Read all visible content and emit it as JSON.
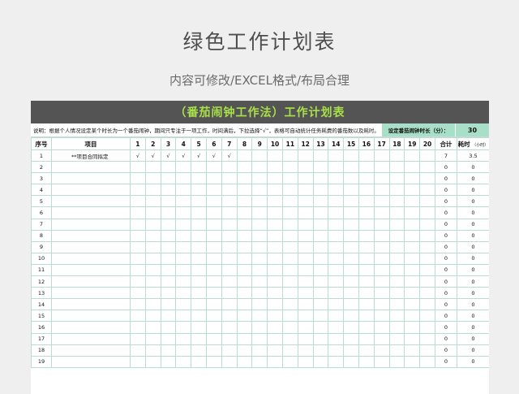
{
  "header": {
    "title": "绿色工作计划表",
    "subtitle": "内容可修改/EXCEL格式/布局合理"
  },
  "sheet": {
    "banner": "（番茄闹钟工作法）工作计划表",
    "description": "说明：根据个人情况设定某个时长为一个番茄闹钟，期间只专注于一项工作，时间满后，下拉选择“√”，表格可自动统计任务耗费的番茄数以及耗时。",
    "duration_label": "设定番茄闹钟时长（分）：",
    "duration_value": "30",
    "columns": {
      "index": "序号",
      "item": "项目",
      "slots": [
        "1",
        "2",
        "3",
        "4",
        "5",
        "6",
        "7",
        "8",
        "9",
        "10",
        "11",
        "12",
        "13",
        "14",
        "15",
        "16",
        "17",
        "18",
        "19",
        "20"
      ],
      "total": "合计",
      "time": "耗时",
      "time_unit": "（小时）"
    },
    "rows": [
      {
        "index": "1",
        "item": "**项目合同拟定",
        "slots": [
          "√",
          "√",
          "√",
          "√",
          "√",
          "√",
          "√",
          "",
          "",
          "",
          "",
          "",
          "",
          "",
          "",
          "",
          "",
          "",
          "",
          ""
        ],
        "total": "7",
        "time": "3.5"
      },
      {
        "index": "2",
        "item": "",
        "slots": [],
        "total": "0",
        "time": "0"
      },
      {
        "index": "3",
        "item": "",
        "slots": [],
        "total": "0",
        "time": "0"
      },
      {
        "index": "4",
        "item": "",
        "slots": [],
        "total": "0",
        "time": "0"
      },
      {
        "index": "5",
        "item": "",
        "slots": [],
        "total": "0",
        "time": "0"
      },
      {
        "index": "6",
        "item": "",
        "slots": [],
        "total": "0",
        "time": "0"
      },
      {
        "index": "7",
        "item": "",
        "slots": [],
        "total": "0",
        "time": "0"
      },
      {
        "index": "8",
        "item": "",
        "slots": [],
        "total": "0",
        "time": "0"
      },
      {
        "index": "9",
        "item": "",
        "slots": [],
        "total": "0",
        "time": "0"
      },
      {
        "index": "10",
        "item": "",
        "slots": [],
        "total": "0",
        "time": "0"
      },
      {
        "index": "11",
        "item": "",
        "slots": [],
        "total": "0",
        "time": "0"
      },
      {
        "index": "12",
        "item": "",
        "slots": [],
        "total": "0",
        "time": "0"
      },
      {
        "index": "13",
        "item": "",
        "slots": [],
        "total": "0",
        "time": "0"
      },
      {
        "index": "14",
        "item": "",
        "slots": [],
        "total": "0",
        "time": "0"
      },
      {
        "index": "15",
        "item": "",
        "slots": [],
        "total": "0",
        "time": "0"
      },
      {
        "index": "16",
        "item": "",
        "slots": [],
        "total": "0",
        "time": "0"
      },
      {
        "index": "17",
        "item": "",
        "slots": [],
        "total": "0",
        "time": "0"
      },
      {
        "index": "18",
        "item": "",
        "slots": [],
        "total": "0",
        "time": "0"
      },
      {
        "index": "19",
        "item": "",
        "slots": [],
        "total": "0",
        "time": "0"
      }
    ]
  },
  "colors": {
    "background": "#efefef",
    "banner_bg": "#545454",
    "banner_text": "#a8e04a",
    "accent_cell": "#a8dfc9",
    "grid_line": "#b9ded0"
  }
}
